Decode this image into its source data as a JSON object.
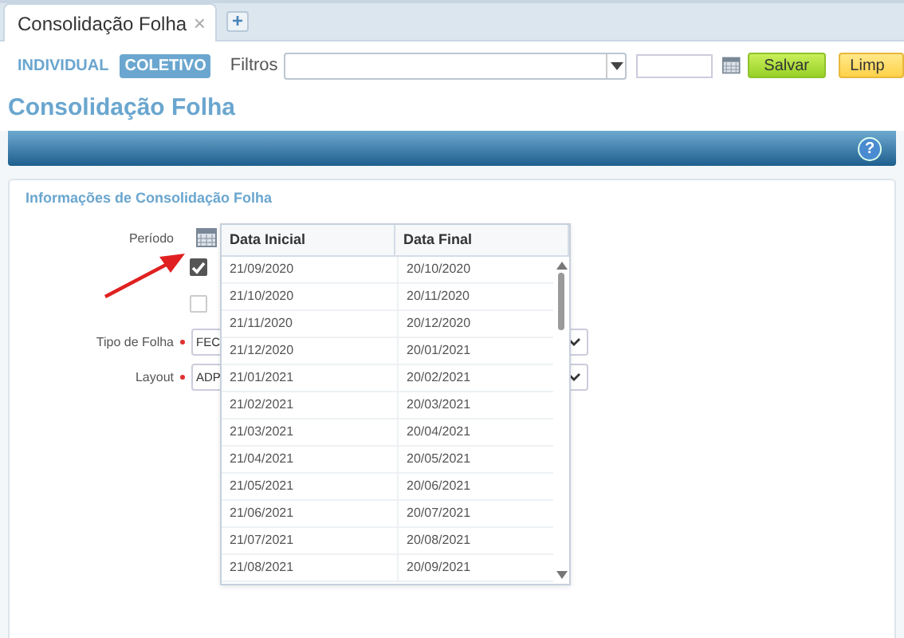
{
  "tabs": [
    {
      "label": "Consolidação Folha",
      "close": "×",
      "selected": true
    }
  ],
  "add_tab": "+",
  "mode_toggle": [
    {
      "label": "INDIVIDUAL",
      "selected": false
    },
    {
      "label": "COLETIVO",
      "selected": true
    }
  ],
  "filters": {
    "label": "Filtros",
    "save": "Salvar",
    "clear": "Limp"
  },
  "page_title": "Consolidação Folha",
  "help": "?",
  "section": {
    "title": "Informações de Consolidação Folha",
    "period_label": "Período",
    "checkboxes": [
      {
        "checked": true
      },
      {
        "checked": false
      }
    ],
    "fields": [
      {
        "label": "Tipo de Folha",
        "value": "FEC",
        "required": true
      },
      {
        "label": "Layout",
        "value": "ADP",
        "required": true
      }
    ]
  },
  "period_popup": {
    "columns": [
      "Data Inicial",
      "Data Final"
    ],
    "rows": [
      [
        "21/09/2020",
        "20/10/2020"
      ],
      [
        "21/10/2020",
        "20/11/2020"
      ],
      [
        "21/11/2020",
        "20/12/2020"
      ],
      [
        "21/12/2020",
        "20/01/2021"
      ],
      [
        "21/01/2021",
        "20/02/2021"
      ],
      [
        "21/02/2021",
        "20/03/2021"
      ],
      [
        "21/03/2021",
        "20/04/2021"
      ],
      [
        "21/04/2021",
        "20/05/2021"
      ],
      [
        "21/05/2021",
        "20/06/2021"
      ],
      [
        "21/06/2021",
        "20/07/2021"
      ],
      [
        "21/07/2021",
        "20/08/2021"
      ],
      [
        "21/08/2021",
        "20/09/2021"
      ]
    ]
  }
}
